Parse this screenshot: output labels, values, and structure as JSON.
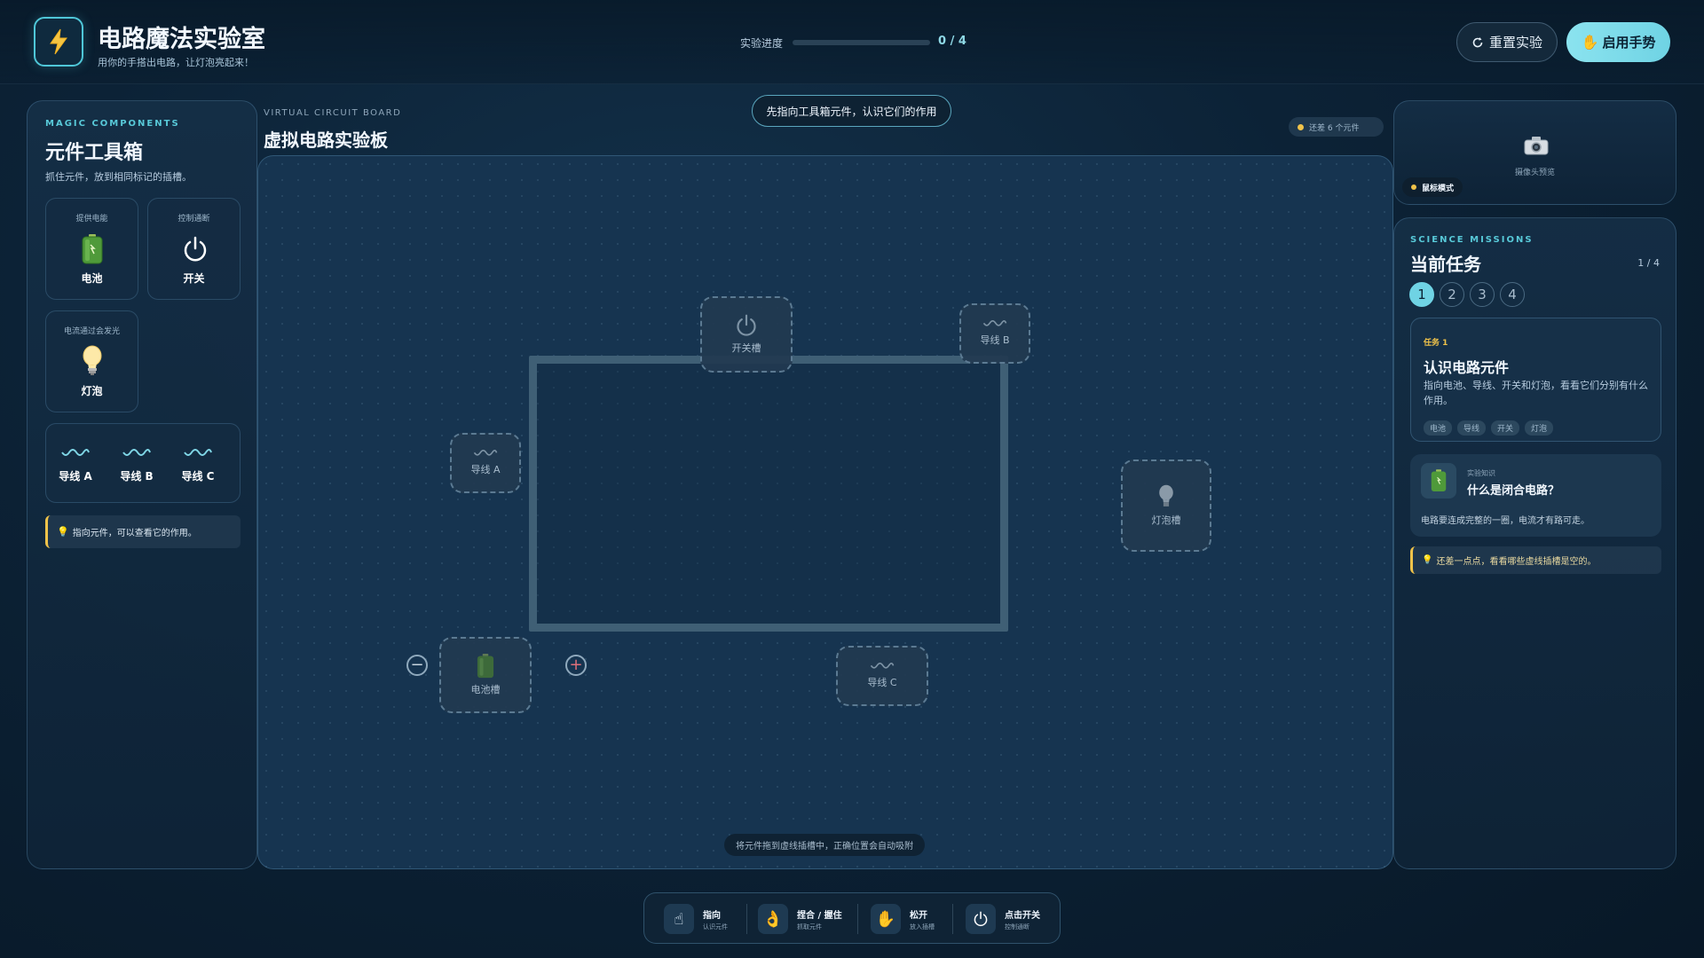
{
  "app": {
    "title": "电路魔法实验室",
    "subtitle": "用你的手搭出电路，让灯泡亮起来！",
    "progress_label": "实验进度",
    "progress_text": "0 / 4",
    "progress_fraction": 0,
    "reset_label": "重置实验",
    "gesture_label": "启用手势"
  },
  "toolbox": {
    "eyebrow": "MAGIC COMPONENTS",
    "title": "元件工具箱",
    "description": "抓住元件，放到相同标记的插槽。",
    "battery": {
      "caption": "提供电能",
      "name": "电池"
    },
    "switch": {
      "caption": "控制通断",
      "name": "开关"
    },
    "bulb": {
      "caption": "电流通过会发光",
      "name": "灯泡"
    },
    "wires": [
      "导线 A",
      "导线 B",
      "导线 C"
    ],
    "tip": "指向元件，可以查看它的作用。"
  },
  "board": {
    "eyebrow": "VIRTUAL CIRCUIT BOARD",
    "title": "虚拟电路实验板",
    "hint": "先指向工具箱元件，认识它们的作用",
    "remaining": "还差 6 个元件",
    "slots": {
      "switch": "开关槽",
      "wire_b": "导线 B",
      "wire_a": "导线 A",
      "bulb": "灯泡槽",
      "battery": "电池槽",
      "wire_c": "导线 C"
    },
    "footer": "将元件拖到虚线插槽中，正确位置会自动吸附"
  },
  "camera": {
    "preview_label": "摄像头预览",
    "mode_badge": "鼠标模式"
  },
  "missions": {
    "eyebrow": "SCIENCE MISSIONS",
    "title": "当前任务",
    "counter": "1 / 4",
    "steps": [
      "1",
      "2",
      "3",
      "4"
    ],
    "active_step": 1,
    "task": {
      "kicker": "任务 1",
      "title": "认识电路元件",
      "description": "指向电池、导线、开关和灯泡，看看它们分别有什么作用。",
      "tags": [
        "电池",
        "导线",
        "开关",
        "灯泡"
      ]
    },
    "knowledge": {
      "kicker": "实验知识",
      "title": "什么是闭合电路？",
      "description": "电路要连成完整的一圈，电流才有路可走。"
    },
    "tip": "还差一点点，看看哪些虚线插槽是空的。"
  },
  "gestures": [
    {
      "title": "指向",
      "sub": "认识元件",
      "icon": "pointing-hand-icon"
    },
    {
      "title": "捏合 / 握住",
      "sub": "抓取元件",
      "icon": "pinch-hand-icon"
    },
    {
      "title": "松开",
      "sub": "放入插槽",
      "icon": "open-hand-icon"
    },
    {
      "title": "点击开关",
      "sub": "控制通断",
      "icon": "power-icon"
    }
  ],
  "colors": {
    "accent": "#6fd3e4",
    "warning": "#f0c34a",
    "background": "#0c2236"
  }
}
